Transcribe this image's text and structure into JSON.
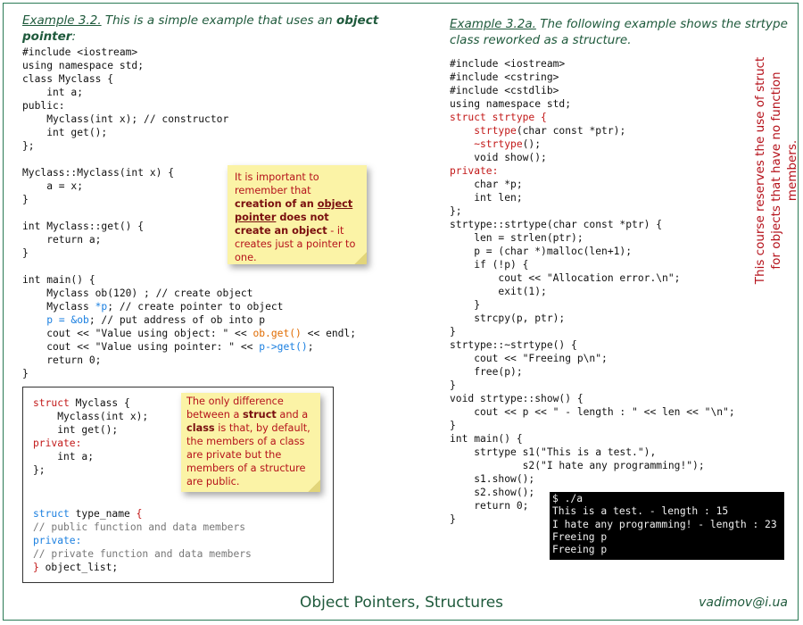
{
  "left": {
    "label": "Example 3.2.",
    "heading_text": " This is a simple example that uses an ",
    "heading_strong": "object pointer",
    "heading_end": ":",
    "code": [
      [
        [
          "#include <iostream>",
          ""
        ]
      ],
      [
        [
          "using namespace std;",
          ""
        ]
      ],
      [
        [
          "class Myclass {",
          ""
        ]
      ],
      [
        [
          "    int a;",
          ""
        ]
      ],
      [
        [
          "public:",
          ""
        ]
      ],
      [
        [
          "    Myclass(int x); // constructor",
          ""
        ]
      ],
      [
        [
          "    int get();",
          ""
        ]
      ],
      [
        [
          "};",
          ""
        ]
      ],
      [
        [
          "",
          ""
        ]
      ],
      [
        [
          "Myclass::Myclass(int x) {",
          ""
        ]
      ],
      [
        [
          "    a = x;",
          ""
        ]
      ],
      [
        [
          "}",
          ""
        ]
      ],
      [
        [
          "",
          ""
        ]
      ],
      [
        [
          "int Myclass::get() {",
          ""
        ]
      ],
      [
        [
          "    return a;",
          ""
        ]
      ],
      [
        [
          "}",
          ""
        ]
      ],
      [
        [
          "",
          ""
        ]
      ],
      [
        [
          "int main() {",
          ""
        ]
      ],
      [
        [
          "    Myclass ob(120) ; // create object",
          ""
        ]
      ],
      [
        [
          "    Myclass ",
          ""
        ],
        [
          "*p",
          "b"
        ],
        [
          "; // create pointer to object",
          ""
        ]
      ],
      [
        [
          "    ",
          ""
        ],
        [
          "p = &ob",
          "b"
        ],
        [
          "; // put address of ob into p",
          ""
        ]
      ],
      [
        [
          "    cout << \"Value using object: \" << ",
          ""
        ],
        [
          "ob.get()",
          "o"
        ],
        [
          " << endl;",
          ""
        ]
      ],
      [
        [
          "    cout << \"Value using pointer: \" << ",
          ""
        ],
        [
          "p->get()",
          "b"
        ],
        [
          ";",
          ""
        ]
      ],
      [
        [
          "    return 0;",
          ""
        ]
      ],
      [
        [
          "}",
          ""
        ]
      ]
    ],
    "note": {
      "t1": "It is important to remember that ",
      "s1": "creation of an ",
      "u1": "object pointer",
      "s2": " does not create an object",
      "t2": " - it creates just a pointer to one."
    }
  },
  "box": {
    "code1": [
      [
        [
          "struct",
          "k"
        ],
        [
          " Myclass {",
          ""
        ]
      ],
      [
        [
          "    Myclass(int x);",
          ""
        ]
      ],
      [
        [
          "    int get();",
          ""
        ]
      ],
      [
        [
          "private:",
          "k"
        ]
      ],
      [
        [
          "    int a;",
          ""
        ]
      ],
      [
        [
          "};",
          ""
        ]
      ]
    ],
    "code2": [
      [
        [
          "struct",
          "b"
        ],
        [
          " type_name ",
          ""
        ],
        [
          "{",
          "k"
        ]
      ],
      [
        [
          "// public function and data members",
          "g"
        ]
      ],
      [
        [
          "private:",
          "b"
        ]
      ],
      [
        [
          "// private function and data members",
          "g"
        ]
      ],
      [
        [
          "} ",
          "k"
        ],
        [
          "object_list;",
          ""
        ]
      ]
    ],
    "note": {
      "t1": "The only difference between a ",
      "s1": "struct",
      "t2": " and a ",
      "s2": "class",
      "t3": " is that, by default, the members of a class are private but the members of a structure are public."
    }
  },
  "right": {
    "label": "Example 3.2a.",
    "heading_text": " The following example shows the strtype class reworked as a structure.",
    "code": [
      [
        [
          "#include <iostream>",
          ""
        ]
      ],
      [
        [
          "#include <cstring>",
          ""
        ]
      ],
      [
        [
          "#include <cstdlib>",
          ""
        ]
      ],
      [
        [
          "using namespace std;",
          ""
        ]
      ],
      [
        [
          "struct strtype {",
          "k"
        ]
      ],
      [
        [
          "    ",
          ""
        ],
        [
          "strtype",
          "k"
        ],
        [
          "(char const *ptr);",
          ""
        ]
      ],
      [
        [
          "    ~strtype",
          "k"
        ],
        [
          "();",
          ""
        ]
      ],
      [
        [
          "    void show();",
          ""
        ]
      ],
      [
        [
          "private:",
          "k"
        ]
      ],
      [
        [
          "    char *p;",
          ""
        ]
      ],
      [
        [
          "    int len;",
          ""
        ]
      ],
      [
        [
          "};",
          ""
        ]
      ],
      [
        [
          "strtype::strtype(char const *ptr) {",
          ""
        ]
      ],
      [
        [
          "    len = strlen(ptr);",
          ""
        ]
      ],
      [
        [
          "    p = (char *)malloc(len+1);",
          ""
        ]
      ],
      [
        [
          "    if (!p) {",
          ""
        ]
      ],
      [
        [
          "        cout << \"Allocation error.\\n\";",
          ""
        ]
      ],
      [
        [
          "        exit(1);",
          ""
        ]
      ],
      [
        [
          "    }",
          ""
        ]
      ],
      [
        [
          "    strcpy(p, ptr);",
          ""
        ]
      ],
      [
        [
          "}",
          ""
        ]
      ],
      [
        [
          "strtype::~strtype() {",
          ""
        ]
      ],
      [
        [
          "    cout << \"Freeing p\\n\";",
          ""
        ]
      ],
      [
        [
          "    free(p);",
          ""
        ]
      ],
      [
        [
          "}",
          ""
        ]
      ],
      [
        [
          "void strtype::show() {",
          ""
        ]
      ],
      [
        [
          "    cout << p << \" - length : \" << len << \"\\n\";",
          ""
        ]
      ],
      [
        [
          "}",
          ""
        ]
      ],
      [
        [
          "int main() {",
          ""
        ]
      ],
      [
        [
          "    strtype s1(\"This is a test.\"),",
          ""
        ]
      ],
      [
        [
          "            s2(\"I hate any programming!\");",
          ""
        ]
      ],
      [
        [
          "    s1.show();",
          ""
        ]
      ],
      [
        [
          "    s2.show();",
          ""
        ]
      ],
      [
        [
          "    return 0;",
          ""
        ]
      ],
      [
        [
          "}",
          ""
        ]
      ]
    ],
    "terminal": [
      "$ ./a",
      "This is a test. - length : 15",
      "I hate any programming! - length : 23",
      "Freeing p",
      "Freeing p"
    ]
  },
  "sidebar_note": "This course reserves the use of struct for objects that have no function members.",
  "footer": {
    "title": "Object Pointers, Structures",
    "email": "vadimov@i.ua"
  }
}
